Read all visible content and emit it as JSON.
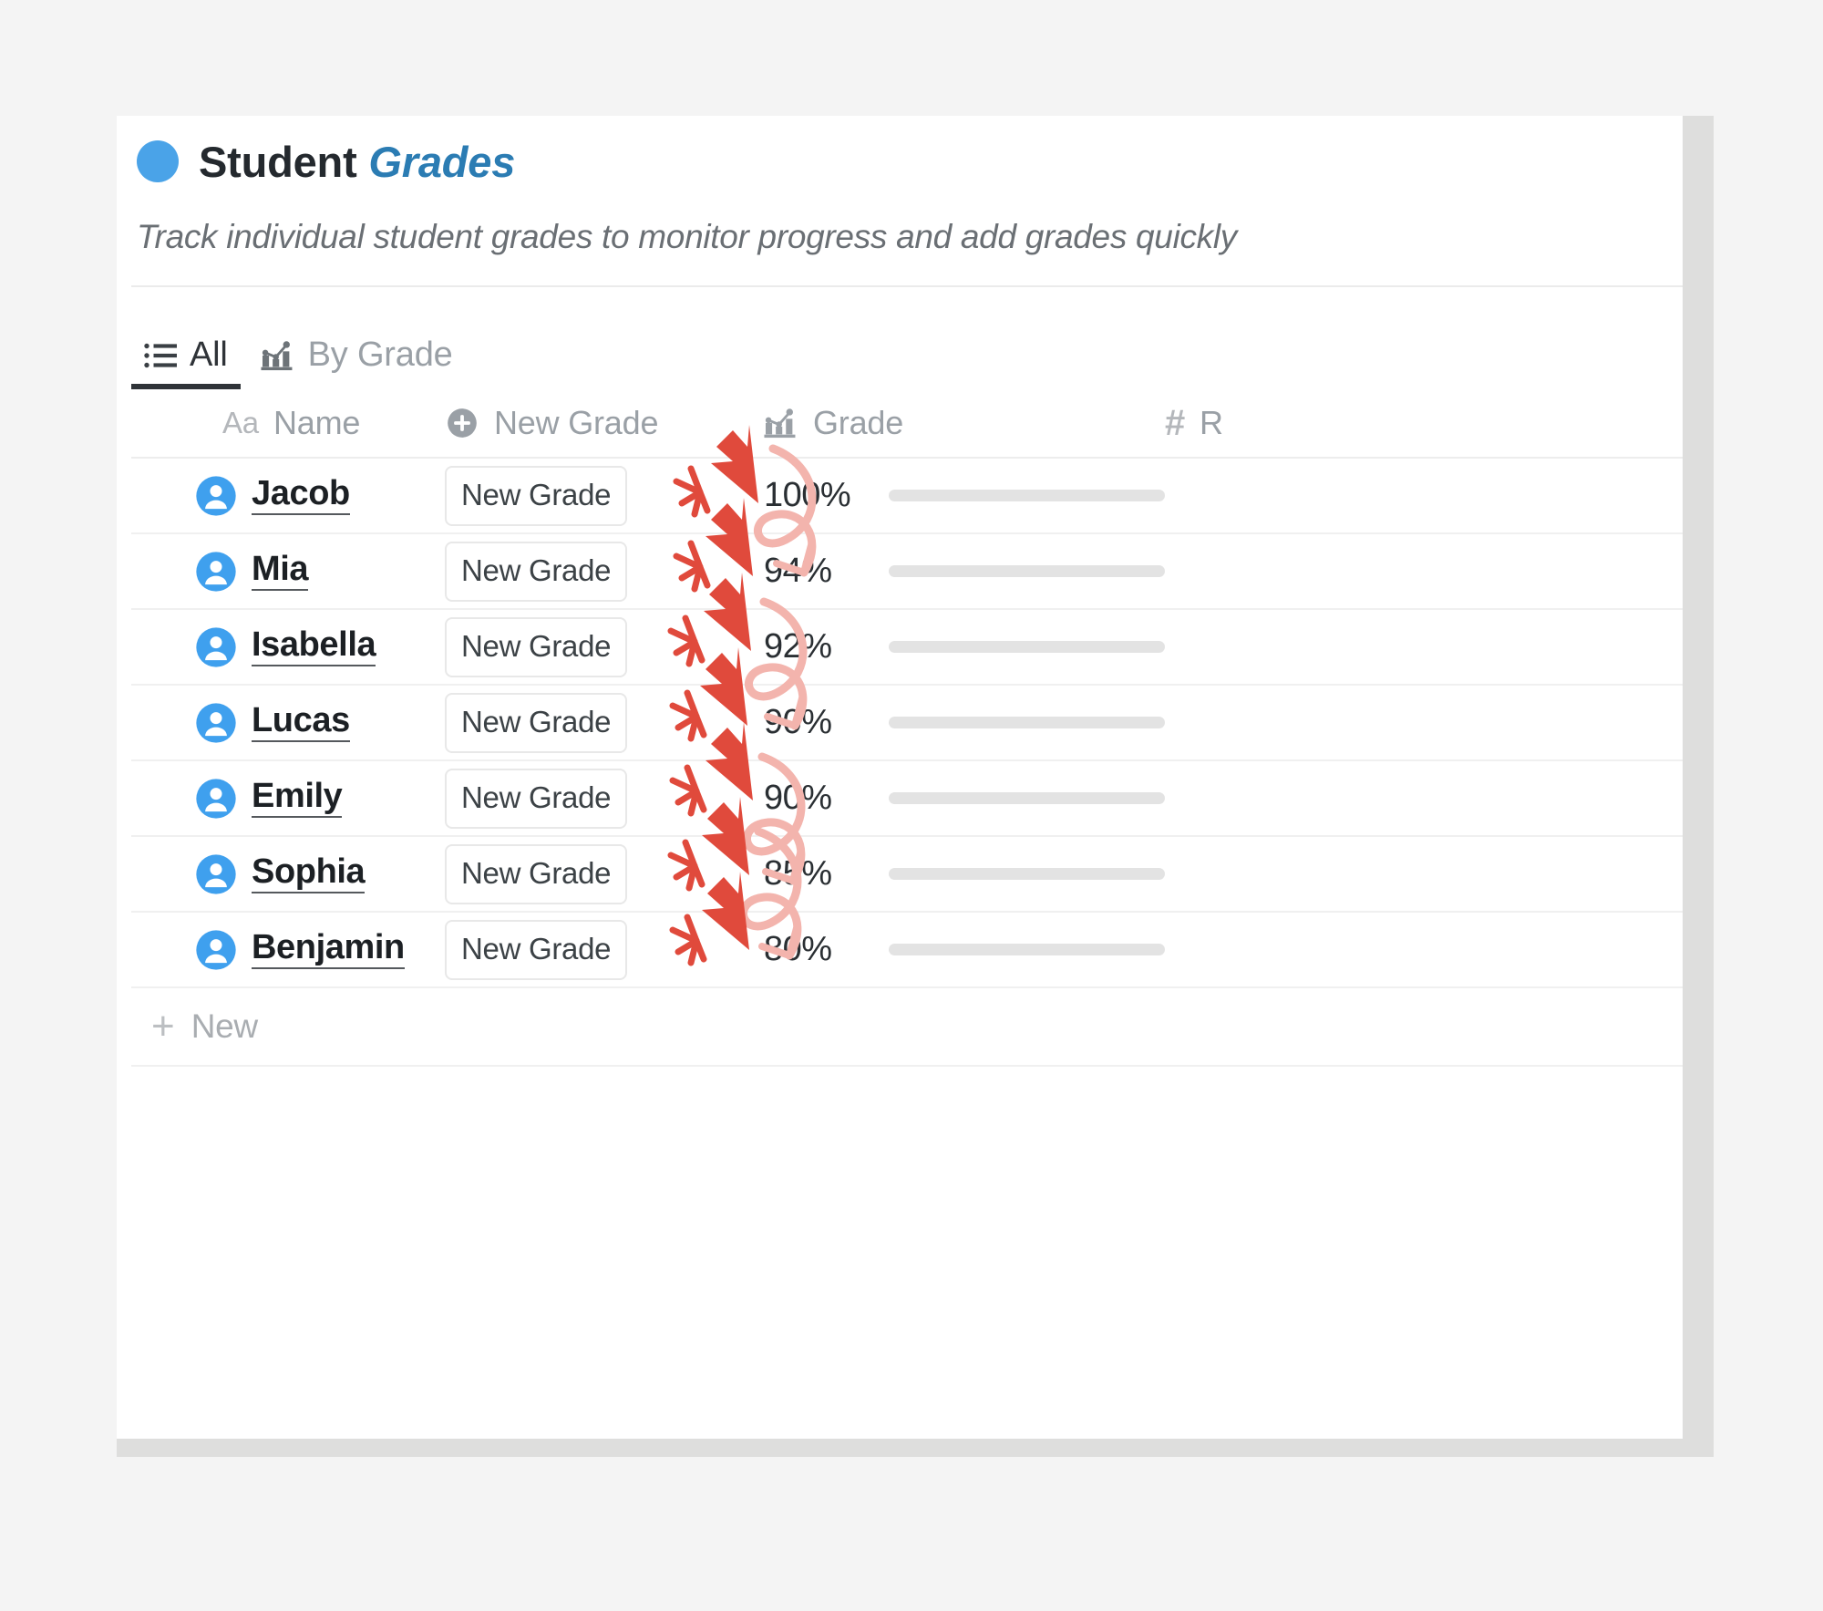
{
  "page": {
    "background_color": "#f4f4f4",
    "card_background": "#ffffff"
  },
  "header": {
    "dot_color": "#4aa3e8",
    "title_plain": "Student ",
    "title_accent": "Grades",
    "subtitle": "Track individual student grades to monitor progress and add grades quickly"
  },
  "tabs": [
    {
      "label": "All",
      "icon": "list-icon",
      "active": true
    },
    {
      "label": "By Grade",
      "icon": "bar-chart-icon",
      "active": false
    }
  ],
  "table": {
    "columns": [
      {
        "key": "name",
        "label": "Name",
        "type_glyph": "Aa",
        "icon": "text-type-icon"
      },
      {
        "key": "new",
        "label": "New Grade",
        "type_glyph": "",
        "icon": "plus-circle-icon"
      },
      {
        "key": "grade",
        "label": "Grade",
        "type_glyph": "",
        "icon": "bar-chart-icon"
      },
      {
        "key": "hash",
        "label": "R",
        "type_glyph": "#",
        "icon": "number-icon"
      }
    ],
    "button_label": "New Grade",
    "add_row_label": "New",
    "rows": [
      {
        "name": "Jacob",
        "new_grade_label": "New Grade",
        "grade": "100%",
        "grade_value": 100
      },
      {
        "name": "Mia",
        "new_grade_label": "New Grade",
        "grade": "94%",
        "grade_value": 94
      },
      {
        "name": "Isabella",
        "new_grade_label": "New Grade",
        "grade": "92%",
        "grade_value": 92
      },
      {
        "name": "Lucas",
        "new_grade_label": "New Grade",
        "grade": "90%",
        "grade_value": 90
      },
      {
        "name": "Emily",
        "new_grade_label": "New Grade",
        "grade": "90%",
        "grade_value": 90
      },
      {
        "name": "Sophia",
        "new_grade_label": "New Grade",
        "grade": "85%",
        "grade_value": 85
      },
      {
        "name": "Benjamin",
        "new_grade_label": "New Grade",
        "grade": "80%",
        "grade_value": 80
      }
    ]
  },
  "chart_data": {
    "type": "bar",
    "title": "Student Grades",
    "categories": [
      "Jacob",
      "Mia",
      "Isabella",
      "Lucas",
      "Emily",
      "Sophia",
      "Benjamin"
    ],
    "values": [
      100,
      94,
      92,
      90,
      90,
      85,
      80
    ],
    "xlabel": "",
    "ylabel": "Grade",
    "ylim": [
      0,
      100
    ],
    "bar_color": "#e06253",
    "track_color": "#e3e3e3",
    "grid": false,
    "legend": "none"
  },
  "annotations": {
    "cursor_color": "#e04a3c",
    "swoosh_color": "#f3b4ad",
    "count": 7,
    "description": "red click cursors on each New Grade button with curved pink flow arrows"
  },
  "colors": {
    "accent_blue": "#2b7cb3",
    "avatar_blue": "#3fa0ee",
    "grade_red": "#e06253",
    "muted_text": "#9aa0a6"
  }
}
